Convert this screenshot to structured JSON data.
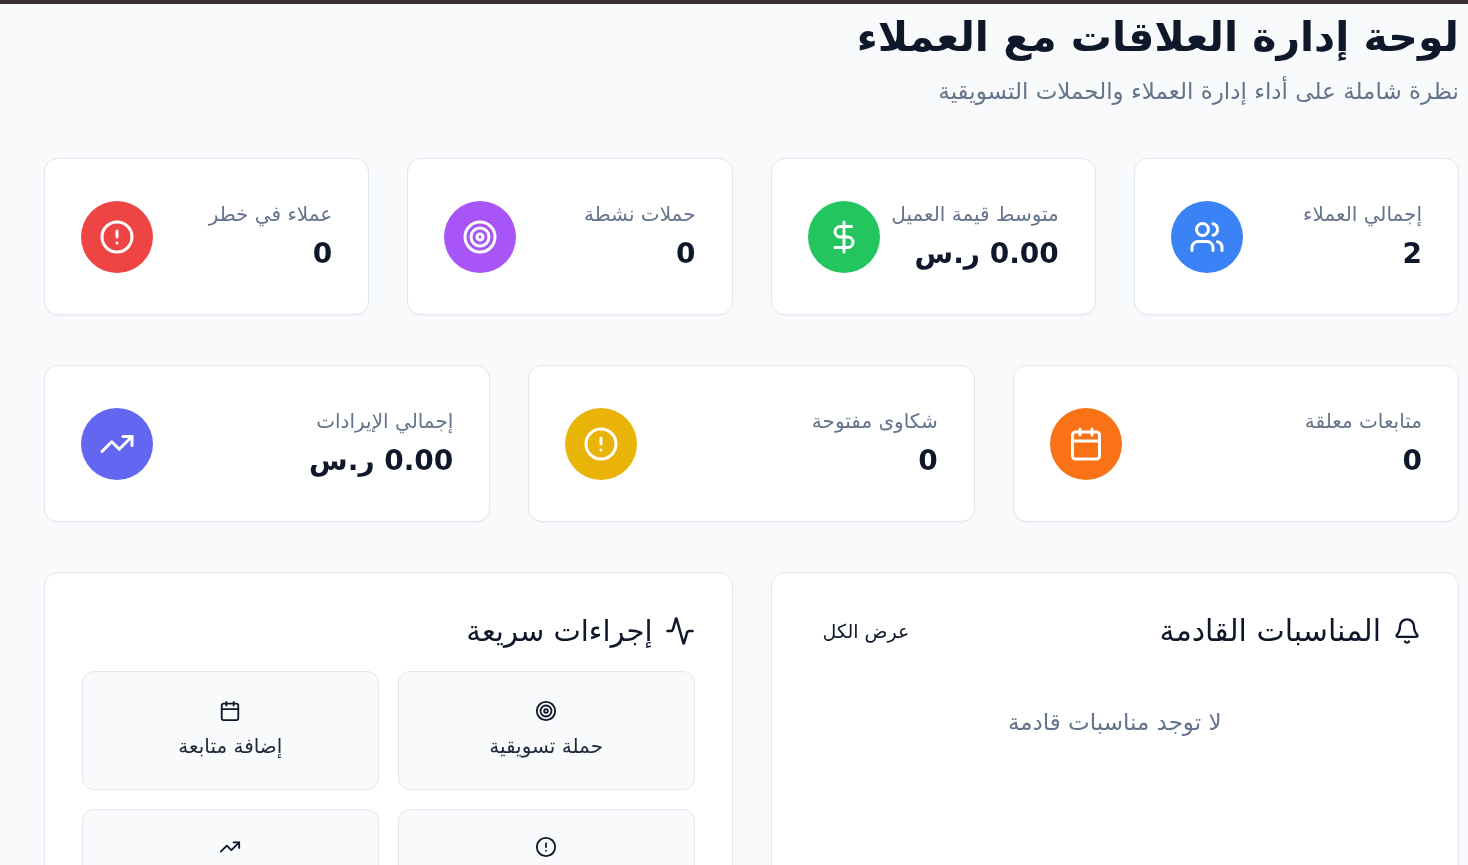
{
  "header": {
    "title": "لوحة إدارة العلاقات مع العملاء",
    "subtitle": "نظرة شاملة على أداء إدارة العملاء والحملات التسويقية"
  },
  "stat_rows": [
    {
      "cards": [
        {
          "label": "إجمالي العملاء",
          "value": "2",
          "color": "#3b82f6"
        },
        {
          "label": "متوسط قيمة العميل",
          "value": "0.00 ر.س",
          "color": "#22c55e"
        },
        {
          "label": "حملات نشطة",
          "value": "0",
          "color": "#a855f7"
        },
        {
          "label": "عملاء في خطر",
          "value": "0",
          "color": "#ef4444"
        }
      ]
    },
    {
      "cards": [
        {
          "label": "متابعات معلقة",
          "value": "0",
          "color": "#f97316"
        },
        {
          "label": "شكاوى مفتوحة",
          "value": "0",
          "color": "#eab308"
        },
        {
          "label": "إجمالي الإيرادات",
          "value": "0.00 ر.س",
          "color": "#6366f1"
        }
      ]
    }
  ],
  "upcoming_events": {
    "title": "المناسبات القادمة",
    "view_all": "عرض الكل",
    "empty_message": "لا توجد مناسبات قادمة"
  },
  "quick_actions": {
    "title": "إجراءات سريعة",
    "items": [
      {
        "kind": "target",
        "label": "حملة تسويقية"
      },
      {
        "kind": "calendar",
        "label": "إضافة متابعة"
      },
      {
        "kind": "alert"
      },
      {
        "kind": "trend"
      }
    ]
  }
}
